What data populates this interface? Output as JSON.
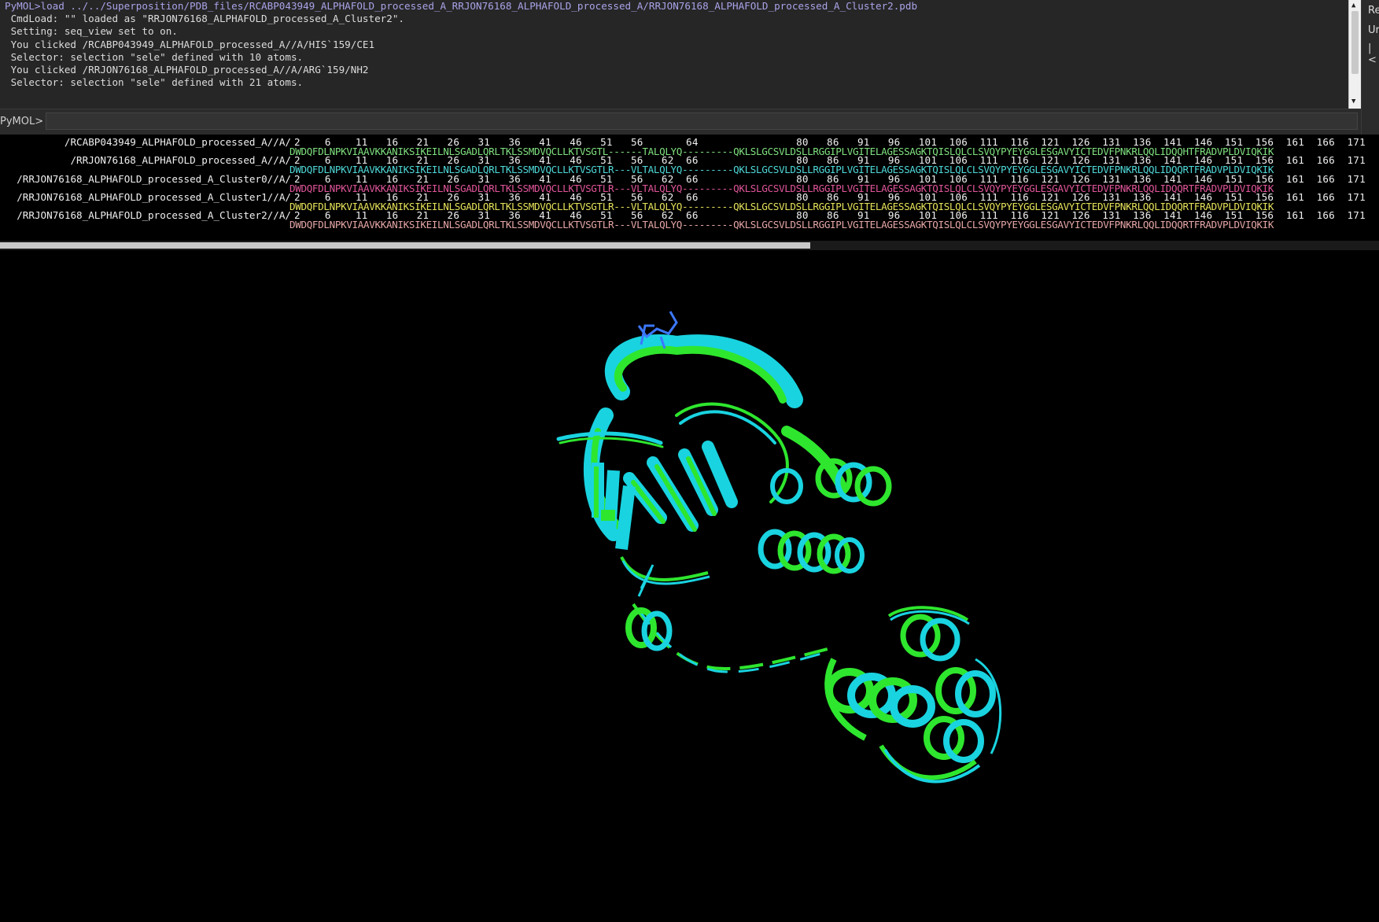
{
  "console": {
    "lines": [
      "PyMOL>load ../../Superposition/PDB_files/RCABP043949_ALPHAFOLD_processed_A_RRJON76168_ALPHAFOLD_processed_A/RRJON76168_ALPHAFOLD_processed_A_Cluster2.pdb",
      " CmdLoad: \"\" loaded as \"RRJON76168_ALPHAFOLD_processed_A_Cluster2\".",
      " Setting: seq_view set to on.",
      " You clicked /RCABP043949_ALPHAFOLD_processed_A//A/HIS`159/CE1",
      " Selector: selection \"sele\" defined with 10 atoms.",
      " You clicked /RRJON76168_ALPHAFOLD_processed_A//A/ARG`159/NH2",
      " Selector: selection \"sele\" defined with 21 atoms."
    ]
  },
  "right_panel": {
    "line1": "Re",
    "line2": "Ur",
    "line3": "|<"
  },
  "command_line": {
    "prompt": "PyMOL>",
    "value": ""
  },
  "sequence_viewer": {
    "numbers": "2    6    11   16   21   26   31   36   41   46   51   56       64                80   86   91   96   101  106  111  116  121  126  131  136  141  146  151  156  161  166  171",
    "numbers_gap": "2    6    11   16   21   26   31   36   41   46   51   56   62  66                80   86   91   96   101  106  111  116  121  126  131  136  141  146  151  156  161  166  171",
    "rows": [
      {
        "name": "/RCABP043949_ALPHAFOLD_processed_A//A/",
        "residues": "DWDQFDLNPKVIAAVKKANIKSIKEILNLSGADLQRLTKLSSMDVQCLLKTVSGTL------TALQLYQ---------QKLSLGCSVLDSLLRGGIPLVGITELAGESSAGKTQISLQLCLSVQYPYEYGGLESGAVYICTEDVFPNKRLQQLIDQQHTFRADVPLDVIQKIK",
        "color": "#7fe07f"
      },
      {
        "name": "/RRJON76168_ALPHAFOLD_processed_A//A/",
        "residues": "DWDQFDLNPKVIAAVKKANIKSIKEILNLSGADLQRLTKLSSMDVQCLLKTVSGTLR---VLTALQLYQ---------QKLSLGCSVLDSLLRGGIPLVGITELAGESSAGKTQISLQLCLSVQYPYEYGGLESGAVYICTEDVFPNKRLQQLIDQQRTFRADVPLDVIQKIK",
        "color": "#4fd8d8"
      },
      {
        "name": "/RRJON76168_ALPHAFOLD_processed_A_Cluster0//A/",
        "residues": "DWDQFDLNPKVIAAVKKANIKSIKEILNLSGADLQRLTKLSSMDVQCLLKTVSGTLR---VLTALQLYQ---------QKLSLGCSVLDSLLRGGIPLVGITELAGESSAGKTQISLQLCLSVQYPYEYGGLESGAVYICTEDVFPNKRLQQLIDQQRTFRADVPLDVIQKIK",
        "color": "#e0559a"
      },
      {
        "name": "/RRJON76168_ALPHAFOLD_processed_A_Cluster1//A/",
        "residues": "DWDQFDLNPKVIAAVKKANIKSIKEILNLSGADLQRLTKLSSMDVQCLLKTVSGTLR---VLTALQLYQ---------QKLSLGCSVLDSLLRGGIPLVGITELAGESSAGKTQISLQLCLSVQYPYEYGGLESGAVYICTEDVFPNKRLQQLIDQQRTFRADVPLDVIQKIK",
        "color": "#e6e25a"
      },
      {
        "name": "/RRJON76168_ALPHAFOLD_processed_A_Cluster2//A/",
        "residues": "DWDQFDLNPKVIAAVKKANIKSIKEILNLSGADLQRLTKLSSMDVQCLLKTVSGTLR---VLTALQLYQ---------QKLSLGCSVLDSLLRGGIPLVGITELAGESSAGKTQISLQLCLSVQYPYEYGGLESGAVYICTEDVFPNKRLQQLIDQQRTFRADVPLDVIQKIK",
        "color": "#e6a6a6"
      }
    ]
  },
  "viewport": {
    "background": "#000000",
    "structure_colors": {
      "model_a": "#2ee62e",
      "model_b": "#19d3e0",
      "sticks": "#3b78ff"
    }
  }
}
